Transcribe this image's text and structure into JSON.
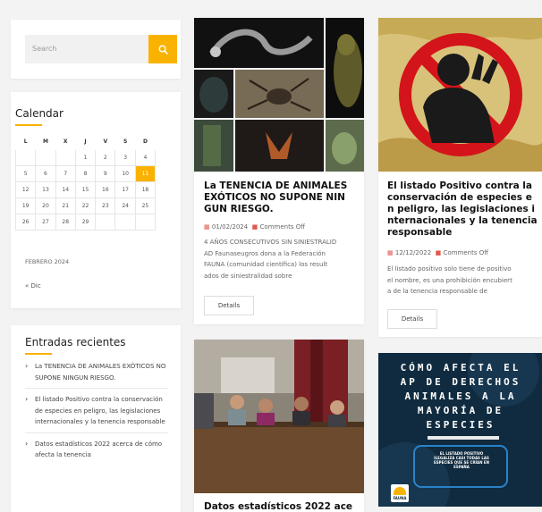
{
  "search": {
    "placeholder": "Search"
  },
  "calendar": {
    "title": "Calendar",
    "weekdays": [
      "L",
      "M",
      "X",
      "J",
      "V",
      "S",
      "D"
    ],
    "weeks": [
      [
        "",
        "",
        "",
        "1",
        "2",
        "3",
        "4"
      ],
      [
        "5",
        "6",
        "7",
        "8",
        "9",
        "10",
        "11"
      ],
      [
        "12",
        "13",
        "14",
        "15",
        "16",
        "17",
        "18"
      ],
      [
        "19",
        "20",
        "21",
        "22",
        "23",
        "24",
        "25"
      ],
      [
        "26",
        "27",
        "28",
        "29",
        "",
        "",
        ""
      ]
    ],
    "today": "11",
    "month_caption": "FEBRERO 2024",
    "prev_link": "« Dic"
  },
  "recent": {
    "title": "Entradas recientes",
    "items": [
      "La TENENCIA DE ANIMALES EXÓTICOS NO SUPONE NINGUN RIESGO.",
      "El listado Positivo contra la conservación de especies en peligro, las legislaciones internacionales y la tenencia responsable",
      "Datos estadísticos 2022 acerca de cómo afecta la tenencia"
    ]
  },
  "posts": [
    {
      "title": "La TENENCIA DE ANIMALES EXÓTICOS NO SUPONE NIN GUN RIESGO.",
      "title_lines": [
        "La TENENCIA DE ANIMALES",
        "EXÓTICOS NO SUPONE NIN",
        "GUN RIESGO."
      ],
      "date": "01/02/2024",
      "comments": "Comments Off",
      "excerpt_lines": [
        "4 AÑOS CONSECUTIVOS SIN SINIESTRALID",
        "AD Faunaseugros dona a la Federación",
        "FAUNA (comunidad cientifica) los result",
        "ados de siniestralidad sobre"
      ],
      "details": "Details"
    },
    {
      "title_lines": [
        "El listado Positivo contra la",
        "conservación de especies e",
        "n peligro, las legislaciones i",
        "nternacionales y la tenencia",
        "responsable"
      ],
      "date": "12/12/2022",
      "comments": "Comments Off",
      "excerpt_lines": [
        "El listado positivo solo tiene de positivo",
        "el nombre, es una prohibición encubiert",
        "a de la tenencia responsable de"
      ],
      "details": "Details"
    },
    {
      "title_lines": [
        "Datos estadísticos 2022 ace"
      ]
    }
  ],
  "promo": {
    "lines": [
      "CÓMO AFECTA EL",
      "AP DE DERECHOS",
      "ANIMALES A LA",
      "MAYORÍA DE",
      "ESPECIES"
    ],
    "small_text_lines": [
      "EL LISTADO POSITIVO",
      "ILEGALIZA CASI TODAS LAS",
      "ESPECIES QUE SE CRÍAN EN",
      "ESPAÑA"
    ],
    "logo_text": "FAUNA"
  },
  "colors": {
    "accent": "#f9b200",
    "meta_icon": "#e0584f"
  }
}
